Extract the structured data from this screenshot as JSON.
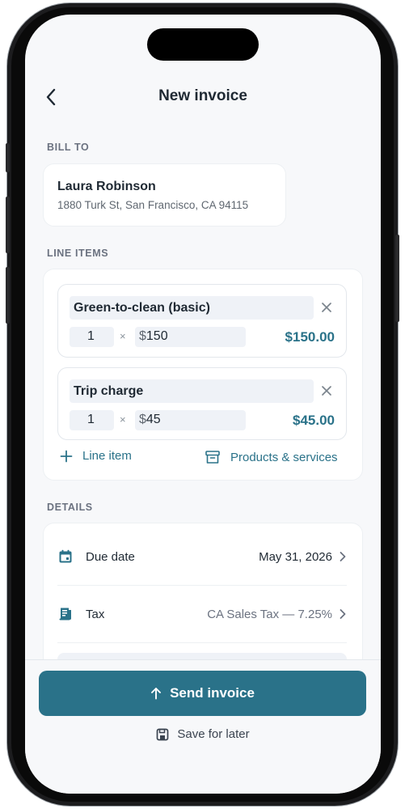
{
  "header": {
    "title": "New invoice"
  },
  "bill_to": {
    "section_label": "BILL TO",
    "name": "Laura Robinson",
    "address": "1880 Turk St, San Francisco, CA 94115"
  },
  "line_items": {
    "section_label": "LINE ITEMS",
    "items": [
      {
        "name": "Green-to-clean (basic)",
        "qty": "1",
        "times": "×",
        "currency": "$",
        "price": "150",
        "total": "$150.00"
      },
      {
        "name": "Trip charge",
        "qty": "1",
        "times": "×",
        "currency": "$",
        "price": "45",
        "total": "$45.00"
      }
    ],
    "add_line_label": "Line item",
    "products_label": "Products & services"
  },
  "details": {
    "section_label": "DETAILS",
    "rows": [
      {
        "label": "Due date",
        "value": "May 31, 2026",
        "icon": "calendar-icon"
      },
      {
        "label": "Tax",
        "value": "CA Sales Tax — 7.25%",
        "icon": "receipt-icon"
      }
    ]
  },
  "actions": {
    "send_label": "Send invoice",
    "save_label": "Save for later"
  },
  "colors": {
    "accent": "#2a7289",
    "background": "#f7f8fa"
  }
}
